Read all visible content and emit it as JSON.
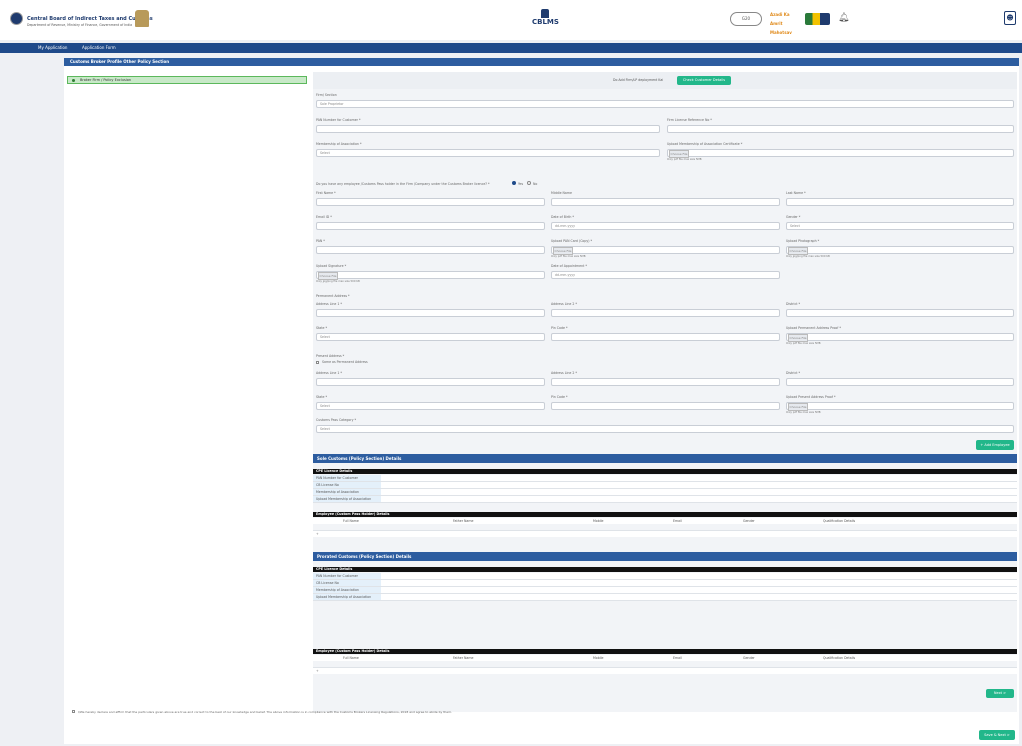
{
  "header": {
    "org_title": "Central Board of Indirect Taxes and Customs",
    "org_sub": "Department of Revenue, Ministry of Finance, Government of India",
    "logo_text": "CBLMS",
    "g20_text": "G20",
    "azadi_text": "Azadi Ka Amrit Mahotsav"
  },
  "nav": {
    "items": [
      "My Application",
      "Application Form"
    ]
  },
  "section_title": "Customs Broker Profile Other Policy Section",
  "left_item": "Broker Firm / Policy Exclusion",
  "top_strip": {
    "text": "Do Add Firm/LP deployment Kai",
    "button": "Check Customer Details"
  },
  "form": {
    "firm_section_label": "Firm/ Section",
    "firm_section_value": "Sole Proprietor",
    "pan_label": "PAN Number for Customer *",
    "license_ref_label": "Firm License Reference No *",
    "membership_label": "Membership of Association *",
    "membership_value": "Select",
    "upload_membership_label": "Upload Membership of Association Certificate *",
    "choose_file": "Choose File",
    "file_hint": "Only pdf file max size 5MB",
    "question": "Do you have any employee /Customs Pass holder in the Firm /Company under the Customs Broker licence? *",
    "yes": "Yes",
    "no": "No",
    "first_name": "First Name *",
    "middle_name": "Middle Name",
    "last_name": "Last Name *",
    "email": "Email ID *",
    "dob": "Date of Birth *",
    "date_placeholder": "dd-mm-yyyy",
    "gender": "Gender *",
    "select": "Select",
    "pan": "PAN *",
    "upload_pan": "Upload PAN Card (Copy) *",
    "upload_photo": "Upload Photograph *",
    "photo_hint": "Only jpg/png file max size 500 KB",
    "upload_sign": "Upload Signature *",
    "sign_hint": "Only jpg/png file max size 500 KB",
    "date_appointment": "Date of Appointment *",
    "permanent_address": "Permanent Address *",
    "address1": "Address Line 1 *",
    "address2": "Address Line 2 *",
    "district": "District *",
    "state": "State *",
    "pincode": "Pin Code *",
    "upload_perm_proof": "Upload Permanent Address Proof *",
    "present_address": "Present Address *",
    "same_as_perm": "Same as Permanent Address",
    "upload_present_proof": "Upload Present Address Proof *",
    "customs_pass_category": "Customs Pass Category *",
    "add_employee": "+ Add Employee"
  },
  "panels": [
    {
      "title": "Sole Customs (Policy Section) Details",
      "license_head": "CPE Licence Details",
      "rows": [
        "PAN Number for Customer",
        "CB License No",
        "Membership of Association",
        "Upload Membership of Association"
      ],
      "employee_head": "Employee (Custom Pass Holder) Details",
      "columns": [
        "Full Name",
        "Father Name",
        "Mobile",
        "Email",
        "Gender",
        "Qualification Details"
      ],
      "empty": "+"
    },
    {
      "title": "Prorated Customs (Policy Section) Details",
      "license_head": "CPE Licence Details",
      "rows": [
        "PAN Number for Customer",
        "CB License No",
        "Membership of Association",
        "Upload Membership of Association"
      ],
      "employee_head": "Employee (Custom Pass Holder) Details",
      "columns": [
        "Full Name",
        "Father Name",
        "Mobile",
        "Email",
        "Gender",
        "Qualification Details"
      ],
      "empty": "+"
    }
  ],
  "buttons": {
    "next": "Next >",
    "save_submit": "Save & Next >"
  },
  "footer_note": "I/We hereby declare and affirm that the particulars given above are true and correct to the best of our knowledge and belief. The above information is in compliance with the Customs Brokers Licensing Regulations, 2018 and agree to abide by them."
}
